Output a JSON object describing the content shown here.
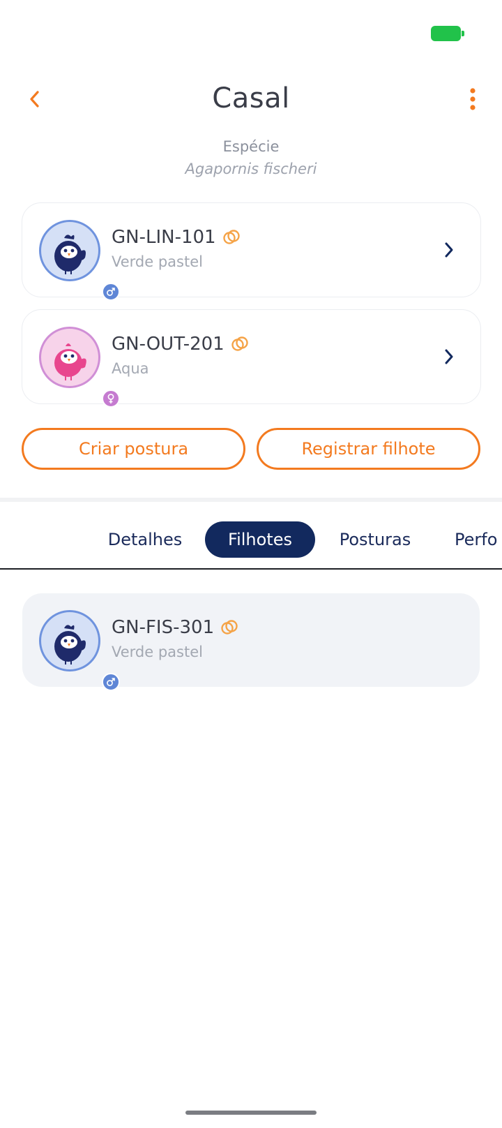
{
  "status_bar": {
    "battery_color": "#21c24a"
  },
  "header": {
    "title": "Casal",
    "back_icon": "chevron-left-icon",
    "menu_icon": "more-vertical-icon"
  },
  "species": {
    "label": "Espécie",
    "name": "Agapornis fischeri"
  },
  "parents": [
    {
      "code": "GN-LIN-101",
      "color": "Verde pastel",
      "sex": "male"
    },
    {
      "code": "GN-OUT-201",
      "color": "Aqua",
      "sex": "female"
    }
  ],
  "actions": {
    "create_clutch": "Criar postura",
    "register_chick": "Registrar filhote"
  },
  "tabs": [
    {
      "label": "Detalhes",
      "active": false
    },
    {
      "label": "Filhotes",
      "active": true
    },
    {
      "label": "Posturas",
      "active": false
    },
    {
      "label": "Perfo",
      "active": false
    }
  ],
  "children": [
    {
      "code": "GN-FIS-301",
      "color": "Verde pastel",
      "sex": "male"
    }
  ],
  "colors": {
    "accent": "#f37a1f",
    "navy": "#12295e",
    "male": "#5f86d6",
    "female": "#c57bd0"
  }
}
